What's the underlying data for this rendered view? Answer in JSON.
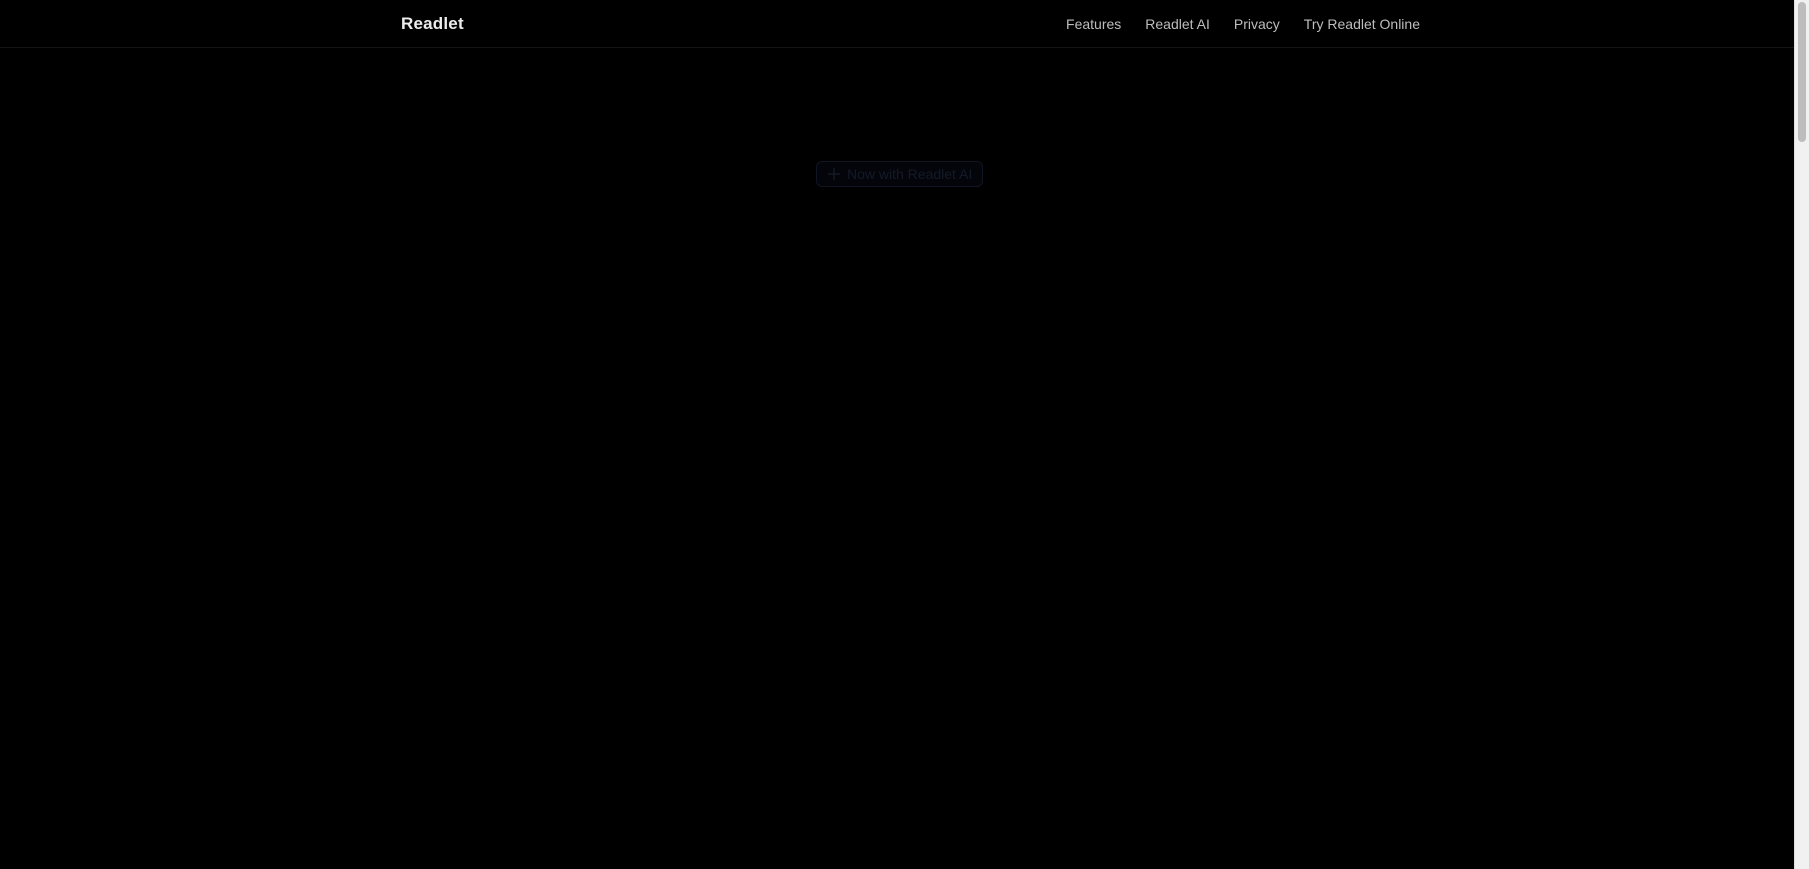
{
  "header": {
    "brand": "Readlet",
    "nav": [
      {
        "label": "Features"
      },
      {
        "label": "Readlet AI"
      },
      {
        "label": "Privacy"
      },
      {
        "label": "Try Readlet Online"
      }
    ]
  },
  "hero": {
    "badge": {
      "icon": "plus-icon",
      "label": "Now with Readlet AI"
    }
  },
  "colors": {
    "background": "#000000",
    "brand_text": "#ececec",
    "nav_text": "#bdbdbd",
    "badge_text": "#151a28",
    "scrollbar_track": "#f1f1f1",
    "scrollbar_thumb": "#bdbdbd"
  },
  "scroll": {
    "position_fraction": 0.0
  }
}
